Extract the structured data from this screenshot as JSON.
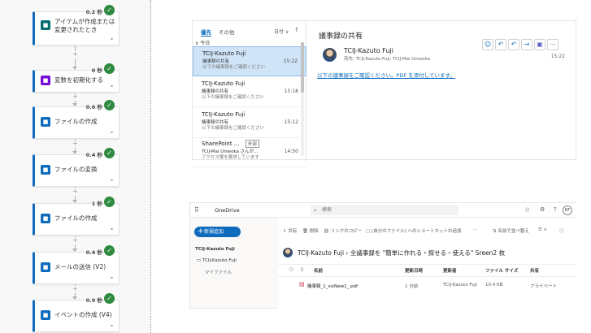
{
  "flow": {
    "steps": [
      {
        "time": "0.2 秒",
        "label": "アイテムが作成または変更されたとき",
        "icon_color": "#036c70",
        "icon": "sharepoint-icon"
      },
      {
        "time": "0 秒",
        "label": "変数を初期化する",
        "icon_color": "#770bd6",
        "icon": "variable-icon"
      },
      {
        "time": "0.6 秒",
        "label": "ファイルの作成",
        "icon_color": "#0f6cbd",
        "icon": "onedrive-icon"
      },
      {
        "time": "0.4 秒",
        "label": "ファイルの変換",
        "icon_color": "#0f6cbd",
        "icon": "onedrive-icon"
      },
      {
        "time": "1 秒",
        "label": "ファイルの作成",
        "icon_color": "#0f6cbd",
        "icon": "onedrive-icon"
      },
      {
        "time": "0.4 秒",
        "label": "メールの送信 (V2)",
        "icon_color": "#0f6cbd",
        "icon": "outlook-icon"
      },
      {
        "time": "0.9 秒",
        "label": "イベントの作成 (V4)",
        "icon_color": "#0f6cbd",
        "icon": "outlook-icon"
      }
    ]
  },
  "outlook": {
    "tabs": [
      "優先",
      "その他"
    ],
    "sort_label": "日付 ∨",
    "group_label": "∨ 今日",
    "emails": [
      {
        "sender": "TCIJ-Kazuto Fuji",
        "subject": "議事録の共有",
        "preview": "以下の議事録をご確認ください",
        "time": "15:22",
        "badge": ""
      },
      {
        "sender": "TCIJ-Kazuto Fuji",
        "subject": "議事録の共有",
        "preview": "以下の議事録をご確認ください",
        "time": "15:18",
        "badge": ""
      },
      {
        "sender": "TCIJ-Kazuto Fuji",
        "subject": "議事録の共有",
        "preview": "以下の議事録をご確認ください",
        "time": "15:12",
        "badge": ""
      },
      {
        "sender": "SharePoint ...",
        "subject": "TCIJ-Mai Umeoka さんが...",
        "preview": "アクセス権を要求しています",
        "time": "14:50",
        "badge": "外部"
      }
    ],
    "reading": {
      "title": "議事録の共有",
      "sender": "TCIJ-Kazuto Fuji",
      "to": "宛先: TCIJ-Kazuto Fuji; TCIJ-Mai Umeoka",
      "date": "15:22",
      "body": "以下の議事録をご確認ください。PDF を添付しています。"
    }
  },
  "onedrive": {
    "app_name": "OneDrive",
    "search_placeholder": "検索",
    "new_button": "新規追加",
    "me_initials": "KF",
    "nav": [
      "TCIJ-Kazuto Fuji",
      "TCIJ-Kazuto Fuji",
      "マイファイル"
    ],
    "commands": [
      "共有",
      "削除",
      "リンクのコピー",
      "[自分のファイル] へのショートカットの追加",
      "名前で並べ替え"
    ],
    "breadcrumb": "TCIJ-Kazuto Fuji  ›  全議事録を \"簡単に作れる・探せる・使える\" Sreen2 枚",
    "columns": [
      "名前",
      "更新日時",
      "更新者",
      "ファイル サイズ",
      "共有"
    ],
    "file": {
      "name": "議事録_1_sixNew1_.pdf",
      "modified": "1 分前",
      "modified_by": "TCIJ-Kazuto Fuji",
      "size": "10.4 KB",
      "sharing": "プライベート"
    }
  }
}
